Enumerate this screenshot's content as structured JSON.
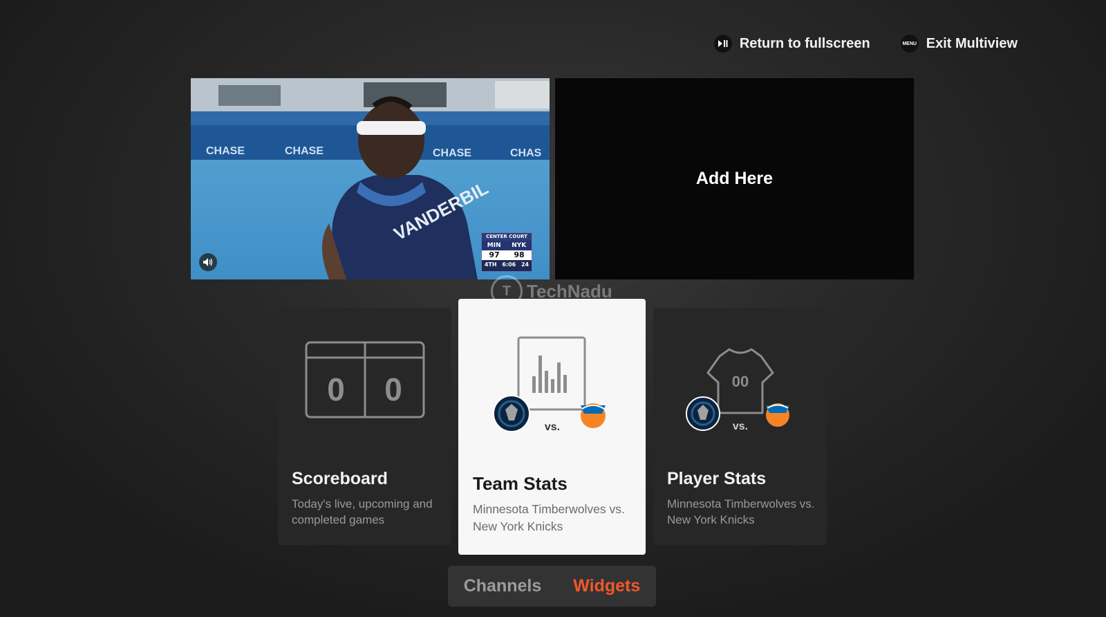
{
  "header": {
    "return_fullscreen_label": "Return to fullscreen",
    "return_fullscreen_icon": "play-pause-icon",
    "exit_multiview_label": "Exit Multiview",
    "exit_multiview_icon_text": "MENU"
  },
  "video_tile": {
    "scorebug": {
      "network": "CENTER COURT",
      "team_away": "MIN",
      "team_home": "NYK",
      "score_away": "97",
      "score_home": "98",
      "period": "4TH",
      "clock": "6:06",
      "shot_clock": "24"
    },
    "icon": "speaker-icon"
  },
  "add_tile": {
    "label": "Add Here"
  },
  "watermark": {
    "text": "TechNadu"
  },
  "widgets": [
    {
      "title": "Scoreboard",
      "subtitle": "Today's live, upcoming and completed games",
      "icon": "scoreboard-icon",
      "scores": [
        "0",
        "0"
      ]
    },
    {
      "title": "Team Stats",
      "subtitle": "Minnesota Timberwolves vs. New York Knicks",
      "icon": "bar-chart-icon",
      "vs": "vs."
    },
    {
      "title": "Player Stats",
      "subtitle": "Minnesota Timberwolves vs. New York Knicks",
      "icon": "jersey-icon",
      "jersey_number": "00",
      "vs": "vs."
    }
  ],
  "tabs": [
    {
      "label": "Channels",
      "active": false
    },
    {
      "label": "Widgets",
      "active": true
    }
  ],
  "colors": {
    "accent": "#f2572b",
    "timberwolves_navy": "#0c2340",
    "knicks_orange": "#f58426",
    "knicks_blue": "#006bb6"
  }
}
